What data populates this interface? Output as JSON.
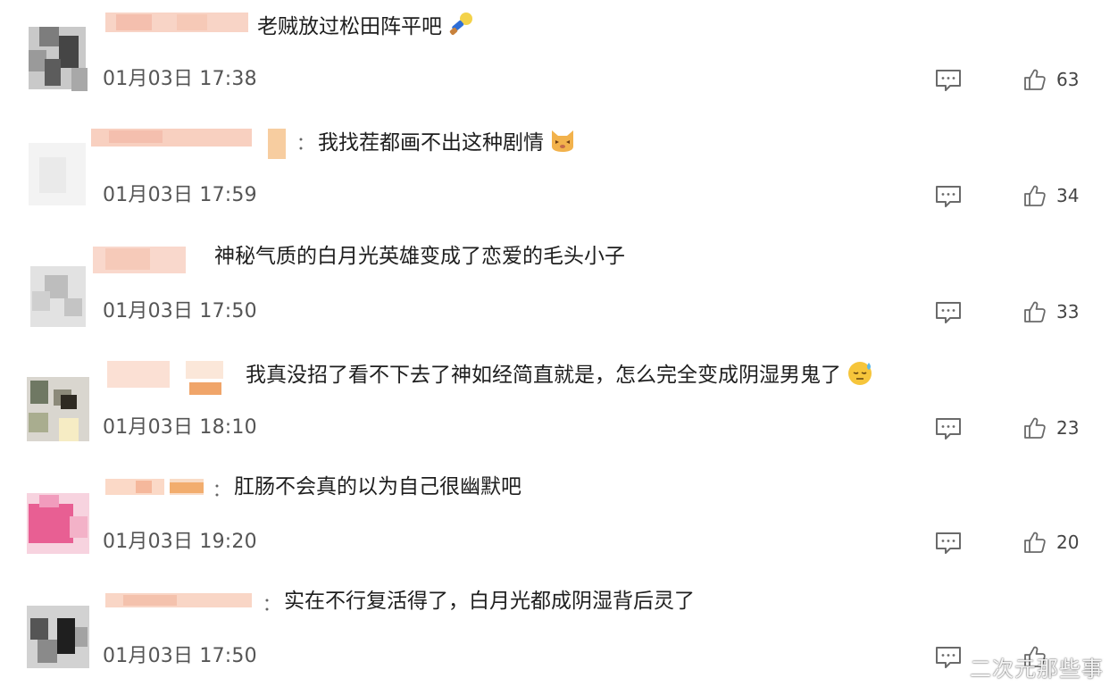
{
  "comments": [
    {
      "text": "老贼放过松田阵平吧",
      "time": "01月03日 17:38",
      "likes": "63",
      "emoji": "microphone"
    },
    {
      "text": "我找茬都画不出这种剧情",
      "time": "01月03日 17:59",
      "likes": "34",
      "emoji": "cat-face"
    },
    {
      "text": "神秘气质的白月光英雄变成了恋爱的毛头小子",
      "time": "01月03日 17:50",
      "likes": "33",
      "emoji": ""
    },
    {
      "text": "我真没招了看不下去了神如经简直就是，怎么完全变成阴湿男鬼了",
      "time": "01月03日 18:10",
      "likes": "23",
      "emoji": "sweat-face"
    },
    {
      "text": "肛肠不会真的以为自己很幽默吧",
      "time": "01月03日 19:20",
      "likes": "20",
      "emoji": ""
    },
    {
      "text": "实在不行复活得了，白月光都成阴湿背后灵了",
      "time": "01月03日 17:50",
      "likes": "",
      "emoji": ""
    }
  ],
  "separator": "：",
  "icons": {
    "reply": "comment-icon",
    "like": "thumbs-up-icon"
  },
  "watermark": "二次元那些事",
  "colors": {
    "text": "#1e1e1e",
    "time": "#555555",
    "icon": "#6a6a6a"
  }
}
